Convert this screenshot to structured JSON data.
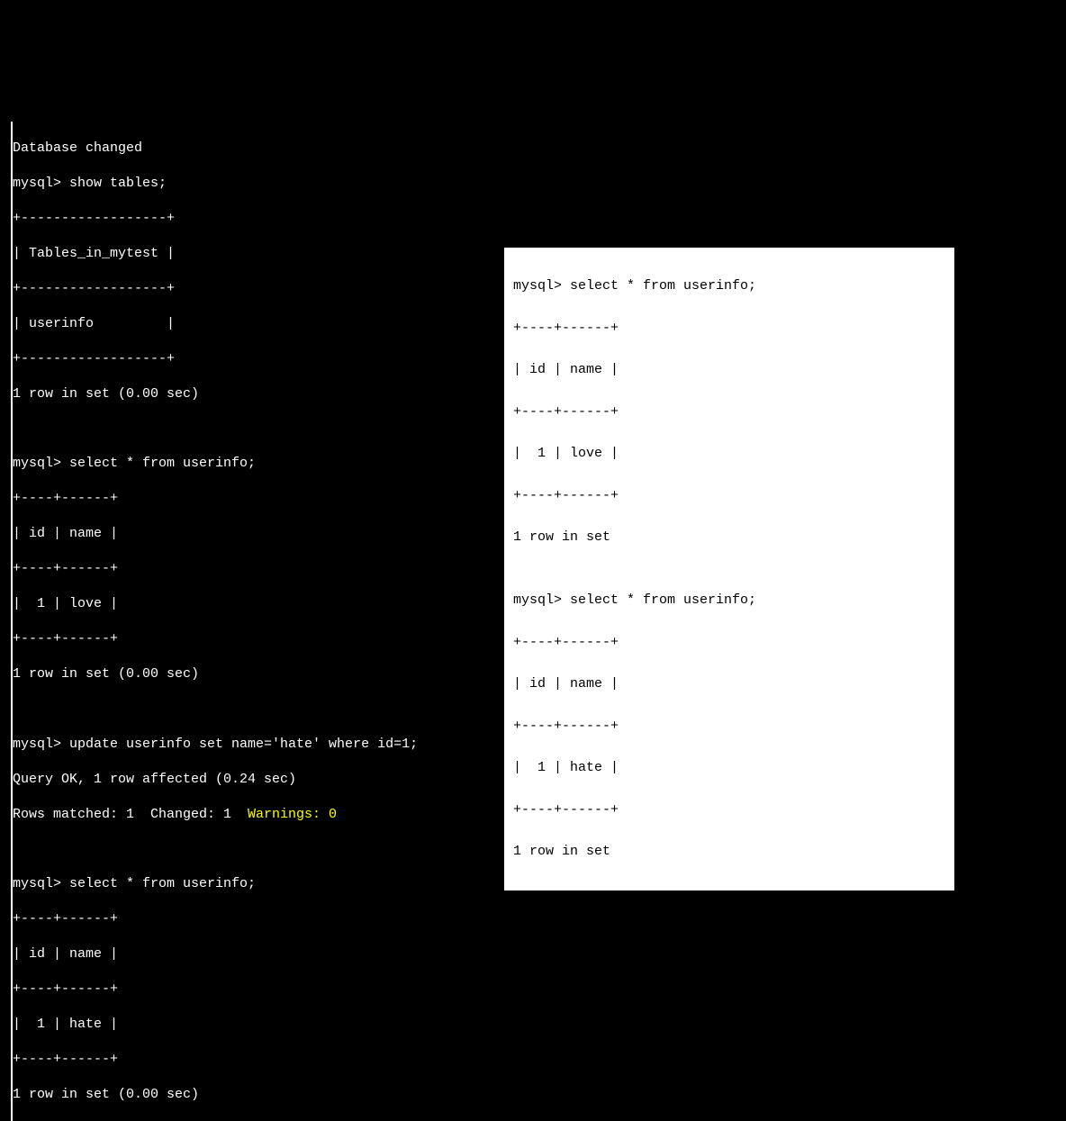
{
  "left_terminal": {
    "db_changed": "Database changed",
    "prompt1": "mysql> show tables;",
    "tables_sep": "+------------------+",
    "tables_header": "| Tables_in_mytest |",
    "tables_row": "| userinfo         |",
    "tables_footer": "1 row in set (0.00 sec)",
    "blank1": "",
    "prompt2": "mysql> select * from userinfo;",
    "sel_sep": "+----+------+",
    "sel_header": "| id | name |",
    "sel_row1": "|  1 | love |",
    "sel_footer1": "1 row in set (0.00 sec)",
    "blank2": "",
    "prompt3": "mysql> update userinfo set name='hate' where id=1;",
    "update_ok": "Query OK, 1 row affected (0.24 sec)",
    "rows_matched_prefix": "Rows matched: 1  Changed: 1  ",
    "warnings_text": "Warnings: 0",
    "blank3": "",
    "prompt4": "mysql> select * from userinfo;",
    "sel_row2": "|  1 | hate |",
    "sel_footer2": "1 row in set (0.00 sec)"
  },
  "right_panel": {
    "prompt1": "mysql> select * from userinfo;",
    "sep": "+----+------+",
    "header": "| id | name |",
    "row1": "|  1 | love |",
    "footer1": "1 row in set",
    "blank": "",
    "prompt2": "mysql> select * from userinfo;",
    "row2": "|  1 | hate |",
    "footer2": "1 row in set"
  }
}
